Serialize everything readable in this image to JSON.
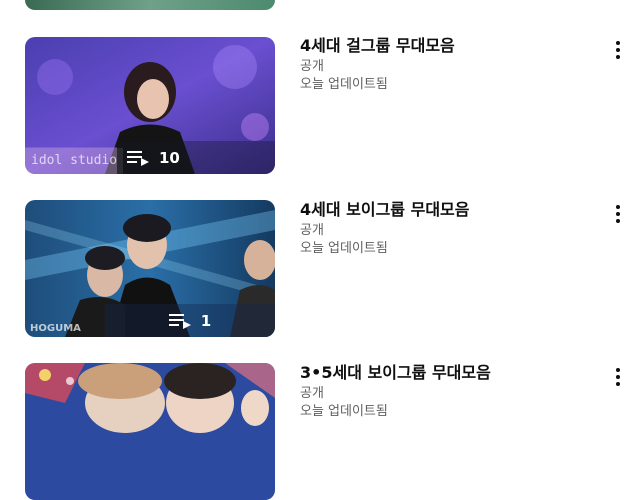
{
  "playlists": [
    {
      "title": "4세대 걸그룹 무대모음",
      "visibility": "공개",
      "updated": "오늘 업데이트됨",
      "count": "10",
      "watermark": "idol studio"
    },
    {
      "title": "4세대 보이그룹 무대모음",
      "visibility": "공개",
      "updated": "오늘 업데이트됨",
      "count": "1",
      "watermark": "HOGUMA"
    },
    {
      "title": "3•5세대 보이그룹 무대모음",
      "visibility": "공개",
      "updated": "오늘 업데이트됨"
    }
  ],
  "icons": {
    "playlist": "playlist-icon",
    "more": "more-vertical-icon"
  }
}
